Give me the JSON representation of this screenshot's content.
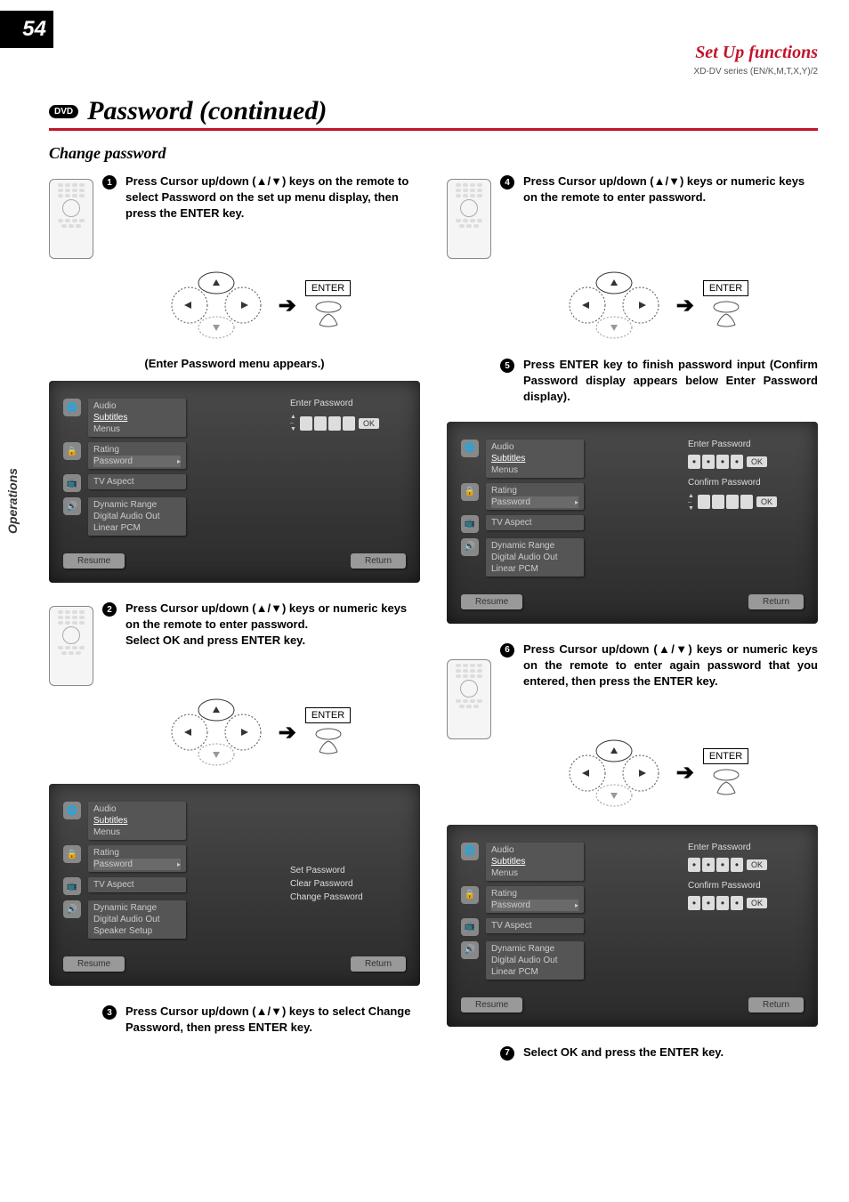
{
  "page_number": "54",
  "header": {
    "title": "Set Up functions",
    "series": "XD-DV series (EN/K,M,T,X,Y)/2"
  },
  "section_badge": "DVD",
  "section_title": "Password (continued)",
  "sub_heading": "Change password",
  "side_tab": "Operations",
  "enter_label": "ENTER",
  "menu_appears_caption": "(Enter Password menu appears.)",
  "steps": {
    "s1": "Press Cursor up/down (▲/▼) keys on the remote to select Password on the set up menu display, then press the ENTER key.",
    "s2_a": "Press Cursor up/down (▲/▼) keys or numeric keys on the remote to enter password.",
    "s2_b": "Select OK and press ENTER key.",
    "s3": "Press Cursor up/down (▲/▼) keys to select Change Password, then press ENTER key.",
    "s4": "Press Cursor up/down (▲/▼) keys or numeric keys on the remote to enter password.",
    "s5": "Press ENTER key to finish password input (Confirm Password display appears below Enter Password display).",
    "s6": "Press Cursor up/down (▲/▼) keys or numeric keys on the remote to enter again password that you entered, then press the ENTER key.",
    "s7": "Select OK and press the ENTER key."
  },
  "menu": {
    "group1": [
      "Audio",
      "Subtitles",
      "Menus"
    ],
    "group2": [
      "Rating",
      "Password"
    ],
    "group3": [
      "TV Aspect"
    ],
    "group4": [
      "Dynamic Range",
      "Digital Audio Out",
      "Linear PCM"
    ],
    "group4b": [
      "Dynamic Range",
      "Digital Audio Out",
      "Speaker Setup"
    ],
    "footer_resume": "Resume",
    "footer_return": "Return",
    "enter_pw": "Enter Password",
    "confirm_pw": "Confirm Password",
    "ok": "OK",
    "actions": [
      "Set Password",
      "Clear Password",
      "Change Password"
    ]
  }
}
